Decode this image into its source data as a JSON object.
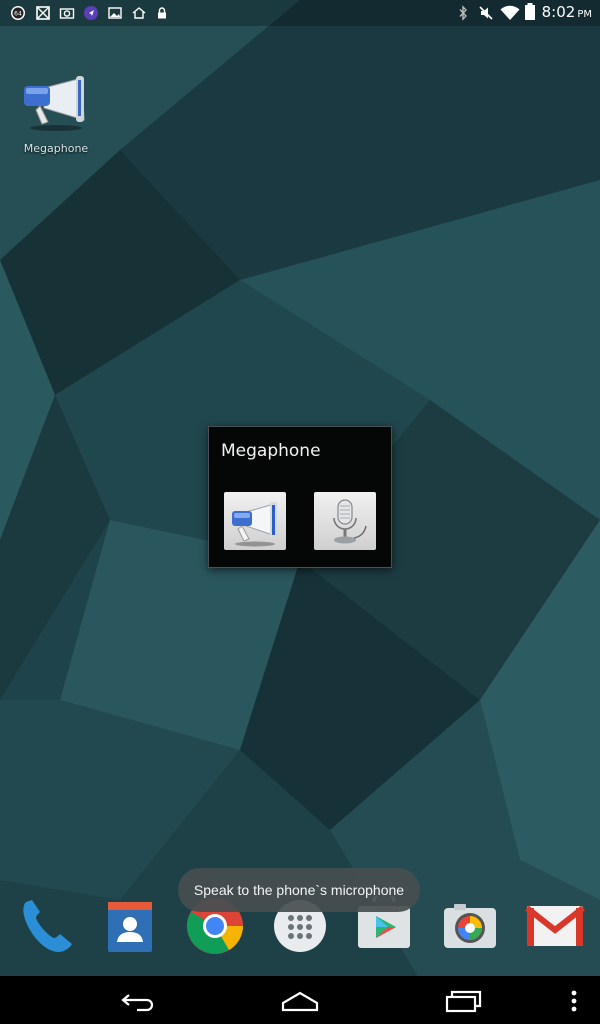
{
  "status_bar": {
    "left_icons": [
      "badge-64-icon",
      "crossed-box-icon",
      "camera-icon",
      "navigation-icon",
      "image-icon",
      "home-icon",
      "lock-icon"
    ],
    "right_icons": [
      "bluetooth-icon",
      "muted-icon",
      "wifi-icon",
      "battery-icon"
    ],
    "badge_text": "64",
    "time": "8:02",
    "ampm": "PM"
  },
  "desktop": {
    "shortcut_label": "Megaphone"
  },
  "widget": {
    "title": "Megaphone",
    "buttons": [
      "megaphone-icon",
      "microphone-icon"
    ]
  },
  "toast": {
    "text": "Speak to the phone`s microphone"
  },
  "dock": {
    "apps": [
      "phone",
      "contacts",
      "chrome",
      "app-drawer",
      "play-store",
      "camera",
      "gmail"
    ]
  },
  "nav_bar": {
    "buttons": [
      "back",
      "home",
      "recents",
      "menu"
    ]
  },
  "colors": {
    "wallpaper_base": "#1c3e44",
    "gmail_red": "#d9372a",
    "phone_blue": "#2a8fd6"
  }
}
